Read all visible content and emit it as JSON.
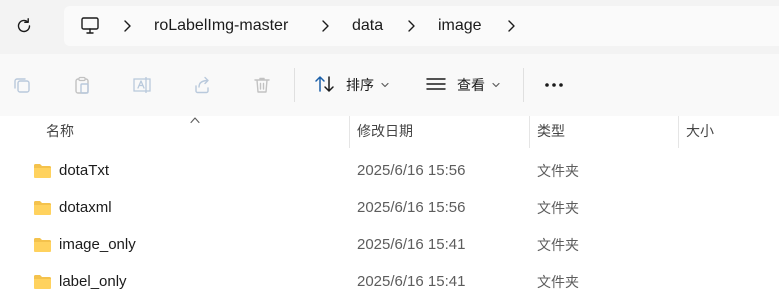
{
  "breadcrumb": {
    "items": [
      "roLabelImg-master",
      "data",
      "image"
    ]
  },
  "toolbar": {
    "sort_label": "排序",
    "view_label": "查看"
  },
  "columns": {
    "name": "名称",
    "date": "修改日期",
    "type": "类型",
    "size": "大小"
  },
  "rows": [
    {
      "name": "dotaTxt",
      "date": "2025/6/16 15:56",
      "type": "文件夹"
    },
    {
      "name": "dotaxml",
      "date": "2025/6/16 15:56",
      "type": "文件夹"
    },
    {
      "name": "image_only",
      "date": "2025/6/16 15:41",
      "type": "文件夹"
    },
    {
      "name": "label_only",
      "date": "2025/6/16 15:41",
      "type": "文件夹"
    }
  ],
  "colors": {
    "folder": "#f4c24c",
    "toolbar_bg": "#f9f9f9",
    "address_bg": "#f3f3f3"
  }
}
